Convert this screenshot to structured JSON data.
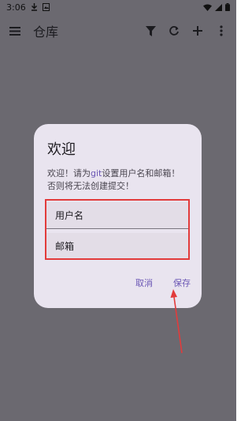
{
  "status_bar": {
    "time": "3:06"
  },
  "app_bar": {
    "title": "仓库"
  },
  "dialog": {
    "title": "欢迎",
    "message_prefix": "欢迎！请为",
    "message_link": "git",
    "message_suffix": "设置用户名和邮箱！否则将无法创建提交！",
    "fields": {
      "username_label": "用户名",
      "email_label": "邮箱"
    },
    "actions": {
      "cancel": "取消",
      "save": "保存"
    }
  },
  "colors": {
    "scrim": "#6b6970",
    "dialog_bg": "#e9e4ef",
    "accent": "#6b57b5",
    "annotation": "#e23b3b"
  }
}
